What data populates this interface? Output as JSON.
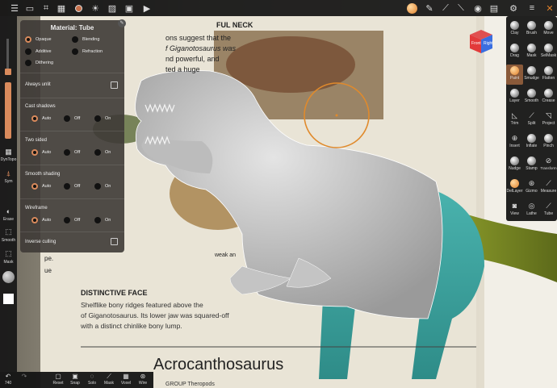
{
  "scene": {
    "book_text": {
      "top_heading": "FUL NECK",
      "top_lines": [
        "ons suggest that the",
        "f Giganotosaurus was",
        "nd powerful, and",
        "ted a huge"
      ],
      "weak_label": "weak an",
      "face_heading": "DISTINCTIVE FACE",
      "face_lines": [
        "Shelflike bony ridges featured above the",
        "of Giganotosaurus. Its lower jaw was squared-off",
        "with a distinct chinlike bony lump."
      ],
      "left_snip": [
        "pe.",
        "ue"
      ],
      "bottom_title": "Acrocanthosaurus",
      "bottom_sub": "GROUP Theropods"
    },
    "colors": {
      "accent": "#d98a5c",
      "selection_ring": "#e08a2c",
      "mesh": "#c8c8c8",
      "tail": "#7a8a2a",
      "leg": "#3fa7a3"
    }
  },
  "top_toolbar": {
    "icons": [
      "menu-icon",
      "folder-icon",
      "scene-icon",
      "grid-icon",
      "material-icon",
      "light-icon",
      "image-icon",
      "video-icon",
      "material-preview",
      "pen-icon",
      "wand-icon",
      "ruler-icon",
      "eye-icon",
      "layers-icon",
      "settings-icon",
      "help-icon"
    ]
  },
  "left_toolbar": {
    "dyntopo_label": "DynTopo",
    "sym_label": "Sym",
    "erase_label": "Erase",
    "smooth_label": "Smooth",
    "mask_label": "Mask"
  },
  "bottom_toolbar": {
    "undo_count": "740",
    "items": [
      "Reset",
      "Snap",
      "Solo",
      "Mask",
      "Voxel",
      "Wire"
    ]
  },
  "gizmo": {
    "front": "Front",
    "right": "Right"
  },
  "right_toolbar": {
    "tools": [
      "Clay",
      "Brush",
      "Move",
      "Drag",
      "Mask",
      "SelMask",
      "Paint",
      "Smudge",
      "Flatten",
      "Layer",
      "Smooth",
      "Crease",
      "Trim",
      "Split",
      "Project",
      "Insert",
      "Inflate",
      "Pinch",
      "Nudge",
      "Stamp",
      "Transform",
      "DelLayer",
      "Gizmo",
      "Measure",
      "View",
      "Lathe",
      "Tube"
    ],
    "active": "Paint"
  },
  "material_panel": {
    "title": "Material: Tube",
    "shading": [
      "Opaque",
      "Blending",
      "Additive",
      "Refraction",
      "Dithering"
    ],
    "shading_selected": "Opaque",
    "always_unlit": "Always unlit",
    "sections": [
      {
        "label": "Cast shadows",
        "options": [
          "Auto",
          "Off",
          "On"
        ],
        "selected": "Auto"
      },
      {
        "label": "Two sided",
        "options": [
          "Auto",
          "Off",
          "On"
        ],
        "selected": "Auto"
      },
      {
        "label": "Smooth shading",
        "options": [
          "Auto",
          "Off",
          "On"
        ],
        "selected": "Auto"
      },
      {
        "label": "Wireframe",
        "options": [
          "Auto",
          "Off",
          "On"
        ],
        "selected": "Auto"
      }
    ],
    "inverse_culling": "Inverse culling"
  }
}
